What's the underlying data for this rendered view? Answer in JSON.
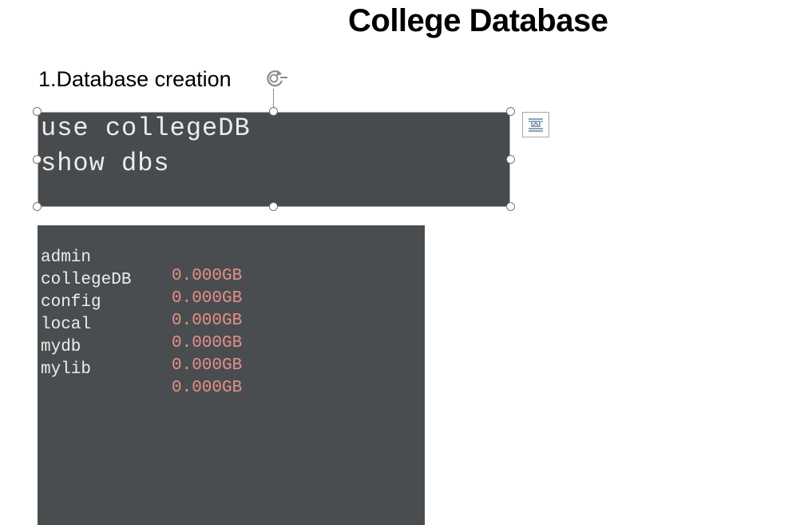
{
  "document": {
    "title": "College Database",
    "section_heading": "1.Database creation"
  },
  "code_image": {
    "lines": [
      "use collegeDB",
      "show dbs"
    ]
  },
  "output_image": {
    "rows": [
      {
        "name": "admin",
        "size": "0.000GB"
      },
      {
        "name": "collegeDB",
        "size": "0.000GB"
      },
      {
        "name": "config",
        "size": "0.000GB"
      },
      {
        "name": "local",
        "size": "0.000GB"
      },
      {
        "name": "mydb",
        "size": "0.000GB"
      },
      {
        "name": "mylib",
        "size": "0.000GB"
      }
    ]
  },
  "icons": {
    "rotate": "rotate-handle-icon",
    "layout_options": "layout-options-icon"
  },
  "colors": {
    "code_background": "#484b4d",
    "code_text": "#ececec",
    "size_text": "#e48f88"
  }
}
